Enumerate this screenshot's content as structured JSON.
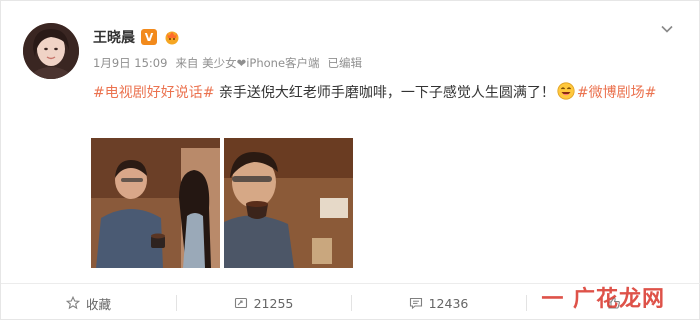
{
  "post": {
    "user_name": "王晓晨",
    "verified_icon": "V",
    "meta": {
      "date": "1月9日 15:09",
      "source": "来自 美少女❤iPhone客户端",
      "edited": "已编辑"
    },
    "text": {
      "hashtag_1": "#电视剧好好说话#",
      "body": " 亲手送倪大红老师手磨咖啡，一下子感觉人生圆满了！",
      "hashtag_2": "#微博剧场#"
    }
  },
  "actions": {
    "favorite": {
      "label": "收藏"
    },
    "repost": {
      "count": "21255"
    },
    "comment": {
      "count": "12436"
    }
  },
  "watermark": {
    "text": "一 广花龙网"
  },
  "colors": {
    "hashtag": "#eb7350",
    "verified": "#f28a1c",
    "watermark": "#d9352a"
  },
  "icons": [
    "avatar",
    "verified-badge",
    "member-badge-icon",
    "chevron-down-icon",
    "laughing-emoji-icon",
    "star-icon",
    "repost-icon",
    "comment-icon",
    "like-icon"
  ]
}
